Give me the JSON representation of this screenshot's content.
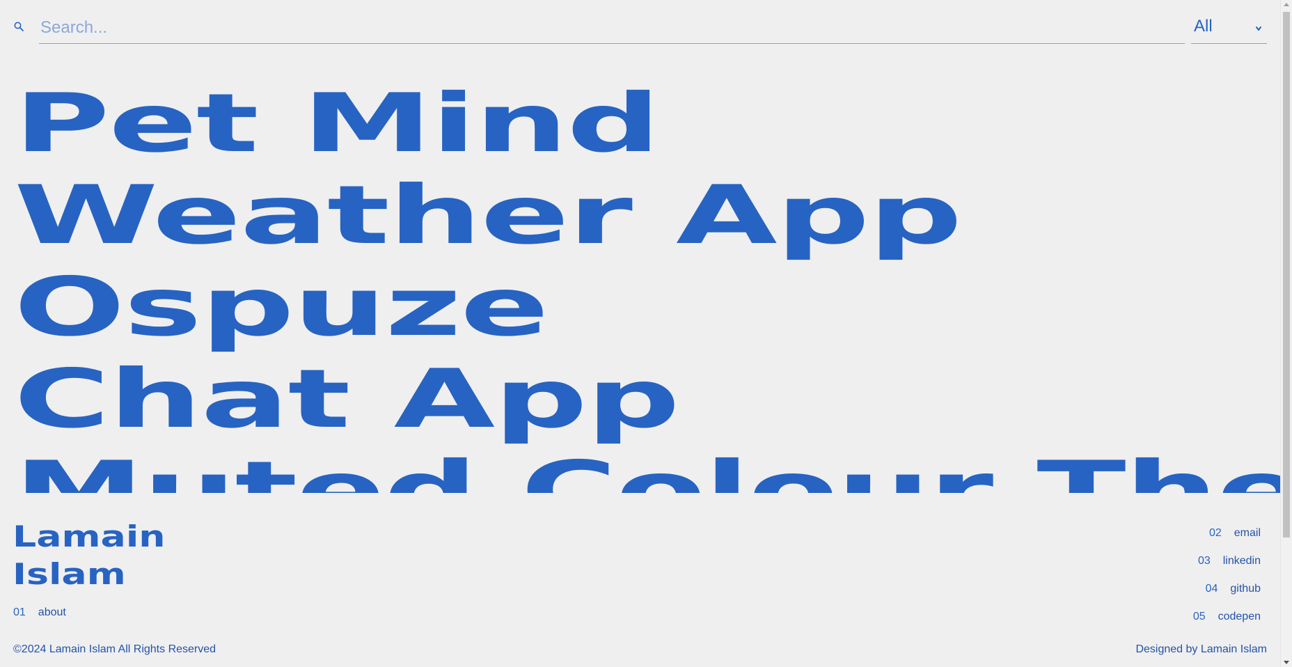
{
  "search": {
    "placeholder": "Search...",
    "icon": "search-icon"
  },
  "filter": {
    "selected": "All",
    "icon": "chevron-down-icon"
  },
  "projects": [
    {
      "title": "Pet Mind"
    },
    {
      "title": "Weather App"
    },
    {
      "title": "Ospuze"
    },
    {
      "title": "Chat App"
    },
    {
      "title": "Muted Colour Theme"
    }
  ],
  "footer": {
    "brand_line1": "Lamain",
    "brand_line2": "Islam",
    "about": {
      "num": "01",
      "label": "about"
    },
    "links": [
      {
        "num": "02",
        "label": "email"
      },
      {
        "num": "03",
        "label": "linkedin"
      },
      {
        "num": "04",
        "label": "github"
      },
      {
        "num": "05",
        "label": "codepen"
      }
    ],
    "copyright": "©2024 Lamain Islam All Rights Reserved",
    "designed_by": "Designed by Lamain Islam"
  },
  "colors": {
    "background": "#efefef",
    "accent": "#2763c2"
  }
}
